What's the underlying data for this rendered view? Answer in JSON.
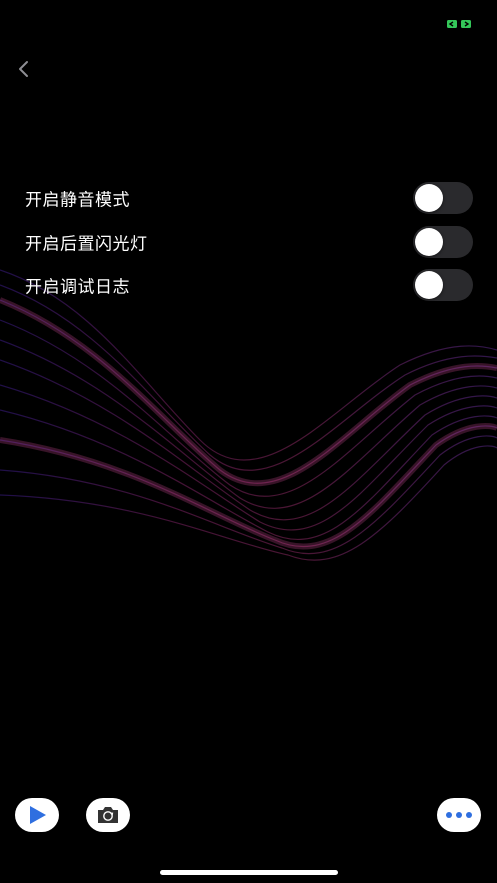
{
  "colors": {
    "background": "#000000",
    "accent_blue": "#2f6fe0",
    "status_green": "#34c759",
    "wave_magenta": "#c0359a",
    "wave_violet": "#6a2bd8"
  },
  "header": {
    "back_icon": "chevron-left-icon",
    "status_icon": "battery-indicator-icon"
  },
  "settings": {
    "items": [
      {
        "label": "开启静音模式",
        "enabled": false
      },
      {
        "label": "开启后置闪光灯",
        "enabled": false
      },
      {
        "label": "开启调试日志",
        "enabled": false
      }
    ]
  },
  "bottom_bar": {
    "play_icon": "play-icon",
    "camera_icon": "camera-switch-icon",
    "more_icon": "more-dots-icon"
  }
}
